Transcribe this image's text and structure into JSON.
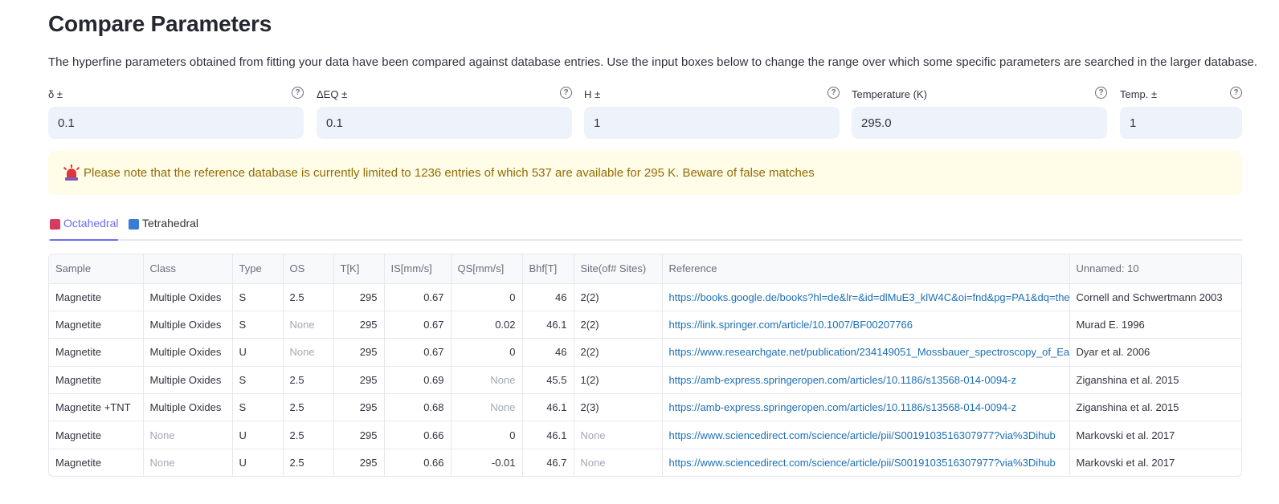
{
  "page": {
    "title": "Compare Parameters",
    "intro": "The hyperfine parameters obtained from fitting your data have been compared against database entries. Use the input boxes below to change the range over which some specific parameters are searched in the larger database."
  },
  "params": [
    {
      "label": "δ ±",
      "value": "0.1"
    },
    {
      "label": "ΔEQ ±",
      "value": "0.1"
    },
    {
      "label": "H ±",
      "value": "1"
    },
    {
      "label": "Temperature (K)",
      "value": "295.0"
    },
    {
      "label": "Temp. ±",
      "value": "1"
    }
  ],
  "help_glyph": "?",
  "warning": {
    "icon": "rotating-light-icon",
    "text": "Please note that the reference database is currently limited to 1236 entries of which 537 are available for 295 K. Beware of false matches"
  },
  "tabs": [
    {
      "label": "Octahedral",
      "color": "#d93a5f",
      "active": true
    },
    {
      "label": "Tetrahedral",
      "color": "#3a7bd5",
      "active": false
    }
  ],
  "colors": {
    "accent": "#6d6df5",
    "link": "#1c6fb5",
    "warning_bg": "#fffce7",
    "warning_text": "#926c05"
  },
  "table": {
    "columns": [
      "Sample",
      "Class",
      "Type",
      "OS",
      "T[K]",
      "IS[mm/s]",
      "QS[mm/s]",
      "Bhf[T]",
      "Site(of# Sites)",
      "Reference",
      "Unnamed: 10"
    ],
    "rows": [
      [
        "Magnetite",
        "Multiple Oxides",
        "S",
        "2.5",
        "295",
        "0.67",
        "0",
        "46",
        "2(2)",
        "https://books.google.de/books?hl=de&lr=&id=dlMuE3_klW4C&oi=fnd&pg=PA1&dq=the",
        "Cornell and Schwertmann 2003"
      ],
      [
        "Magnetite",
        "Multiple Oxides",
        "S",
        "None",
        "295",
        "0.67",
        "0.02",
        "46.1",
        "2(2)",
        "https://link.springer.com/article/10.1007/BF00207766",
        "Murad E. 1996"
      ],
      [
        "Magnetite",
        "Multiple Oxides",
        "U",
        "None",
        "295",
        "0.67",
        "0",
        "46",
        "2(2)",
        "https://www.researchgate.net/publication/234149051_Mossbauer_spectroscopy_of_Ea",
        "Dyar et al. 2006"
      ],
      [
        "Magnetite",
        "Multiple Oxides",
        "S",
        "2.5",
        "295",
        "0.69",
        "None",
        "45.5",
        "1(2)",
        "https://amb-express.springeropen.com/articles/10.1186/s13568-014-0094-z",
        "Ziganshina et al. 2015"
      ],
      [
        "Magnetite +TNT",
        "Multiple Oxides",
        "S",
        "2.5",
        "295",
        "0.68",
        "None",
        "46.1",
        "2(3)",
        "https://amb-express.springeropen.com/articles/10.1186/s13568-014-0094-z",
        "Ziganshina et al. 2015"
      ],
      [
        "Magnetite",
        "None",
        "U",
        "2.5",
        "295",
        "0.66",
        "0",
        "46.1",
        "None",
        "https://www.sciencedirect.com/science/article/pii/S0019103516307977?via%3Dihub",
        "Markovski et al. 2017"
      ],
      [
        "Magnetite",
        "None",
        "U",
        "2.5",
        "295",
        "0.66",
        "-0.01",
        "46.7",
        "None",
        "https://www.sciencedirect.com/science/article/pii/S0019103516307977?via%3Dihub",
        "Markovski et al. 2017"
      ]
    ]
  }
}
